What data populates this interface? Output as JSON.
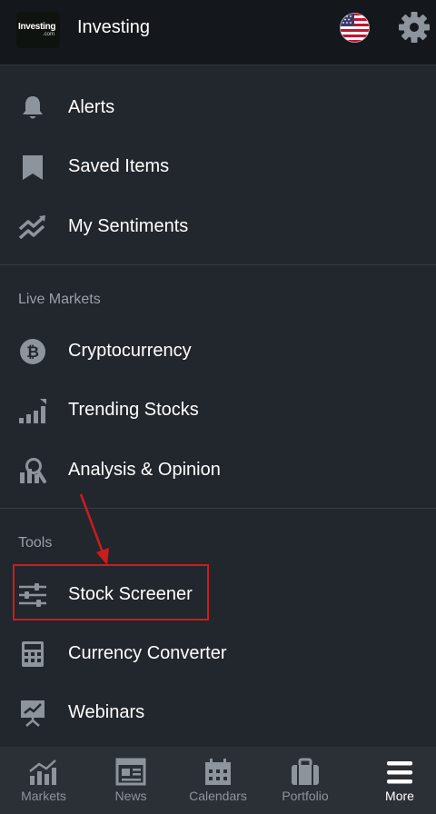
{
  "header": {
    "logo_text": "Investing",
    "logo_sub": ".com",
    "title": "Investing",
    "icons": [
      "us-flag-icon",
      "gear-icon"
    ]
  },
  "menu": {
    "items": [
      {
        "label": "Alerts",
        "icon": "bell-icon"
      },
      {
        "label": "Saved Items",
        "icon": "bookmark-icon"
      },
      {
        "label": "My Sentiments",
        "icon": "sentiment-chart-icon"
      }
    ]
  },
  "live_markets": {
    "title": "Live Markets",
    "items": [
      {
        "label": "Cryptocurrency",
        "icon": "bitcoin-icon"
      },
      {
        "label": "Trending Stocks",
        "icon": "trending-bars-icon"
      },
      {
        "label": "Analysis & Opinion",
        "icon": "analysis-icon"
      }
    ]
  },
  "tools": {
    "title": "Tools",
    "items": [
      {
        "label": "Stock Screener",
        "icon": "sliders-icon"
      },
      {
        "label": "Currency Converter",
        "icon": "calculator-icon"
      },
      {
        "label": "Webinars",
        "icon": "presentation-icon"
      }
    ]
  },
  "bottom_nav": {
    "tabs": [
      {
        "label": "Markets",
        "icon": "markets-icon"
      },
      {
        "label": "News",
        "icon": "news-icon"
      },
      {
        "label": "Calendars",
        "icon": "calendar-icon"
      },
      {
        "label": "Portfolio",
        "icon": "briefcase-icon"
      },
      {
        "label": "More",
        "icon": "hamburger-icon",
        "active": true
      }
    ]
  },
  "colors": {
    "background": "#22262d",
    "header": "#14171c",
    "bottom_nav": "#2b2f36",
    "icon": "#8e949c",
    "highlight": "#c81e1e"
  }
}
